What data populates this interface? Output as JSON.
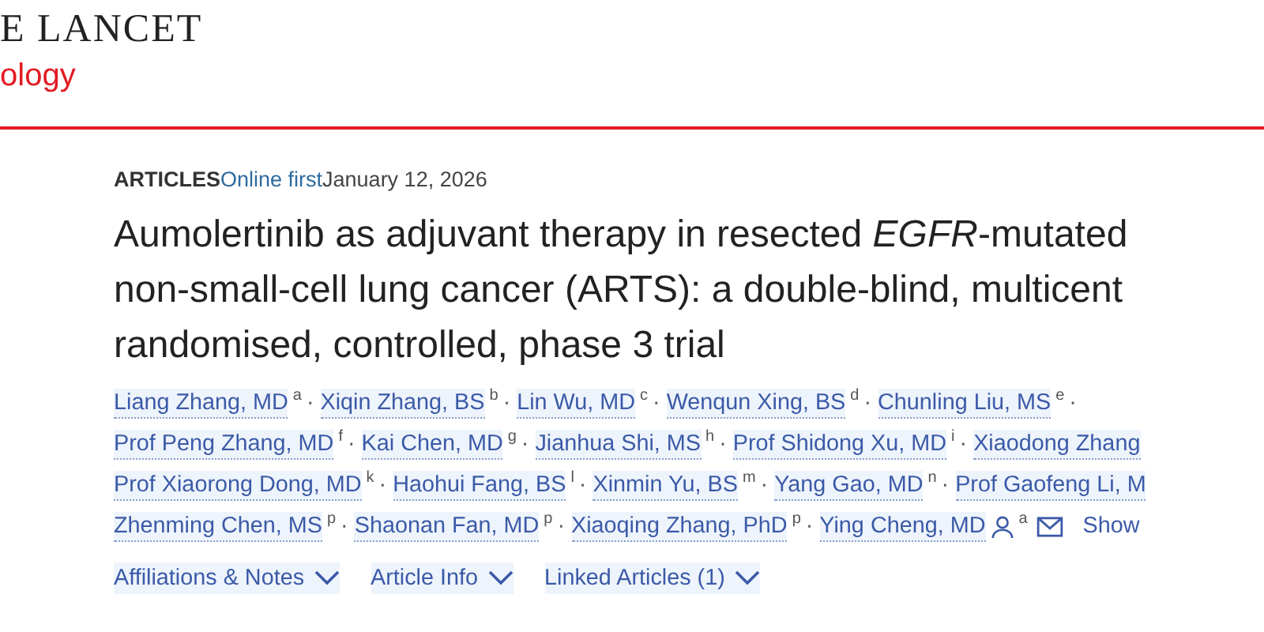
{
  "journal": {
    "name_line1": "E LANCET",
    "name_line2": "ology"
  },
  "meta": {
    "section": "ARTICLES",
    "status": "Online first",
    "date": "January 12, 2026"
  },
  "title": {
    "lines": [
      "Aumolertinib as adjuvant therapy in resected *EGFR*-mutated",
      "non-small-cell lung cancer (ARTS): a double-blind, multicent",
      "randomised, controlled, phase 3 trial"
    ]
  },
  "authors": {
    "lines": [
      [
        {
          "name": "Liang Zhang, MD",
          "sup": "a",
          "after": "·"
        },
        {
          "name": "Xiqin Zhang, BS",
          "sup": "b",
          "after": "·"
        },
        {
          "name": "Lin Wu, MD",
          "sup": "c",
          "after": "·"
        },
        {
          "name": "Wenqun Xing, BS",
          "sup": "d",
          "after": "·"
        },
        {
          "name": "Chunling Liu, MS",
          "sup": "e",
          "after": "·"
        }
      ],
      [
        {
          "name": "Prof Peng Zhang, MD",
          "sup": "f",
          "after": "·"
        },
        {
          "name": "Kai Chen, MD",
          "sup": "g",
          "after": "·"
        },
        {
          "name": "Jianhua Shi, MS",
          "sup": "h",
          "after": "·"
        },
        {
          "name": "Prof Shidong Xu, MD",
          "sup": "i",
          "after": "·"
        },
        {
          "name": "Xiaodong Zhang"
        }
      ],
      [
        {
          "name": "Prof Xiaorong Dong, MD",
          "sup": "k",
          "after": "·"
        },
        {
          "name": "Haohui Fang, BS",
          "sup": "l",
          "after": "·"
        },
        {
          "name": "Xinmin Yu, BS",
          "sup": "m",
          "after": "·"
        },
        {
          "name": "Yang Gao, MD",
          "sup": "n",
          "after": "·"
        },
        {
          "name": "Prof Gaofeng Li, M"
        }
      ],
      [
        {
          "name": "Zhenming Chen, MS",
          "sup": "p",
          "after": "·"
        },
        {
          "name": "Shaonan Fan, MD",
          "sup": "p",
          "after": "·"
        },
        {
          "name": "Xiaoqing Zhang, PhD",
          "sup": "p",
          "after": "·"
        },
        {
          "name": "Ying Cheng, MD",
          "sup": "a",
          "corresponding": true
        }
      ]
    ],
    "email": true,
    "show_link": "Show"
  },
  "tabs": [
    {
      "label": "Affiliations & Notes",
      "expanded": false
    },
    {
      "label": "Article Info",
      "expanded": false
    },
    {
      "label": "Linked Articles (1)",
      "expanded": false
    }
  ]
}
